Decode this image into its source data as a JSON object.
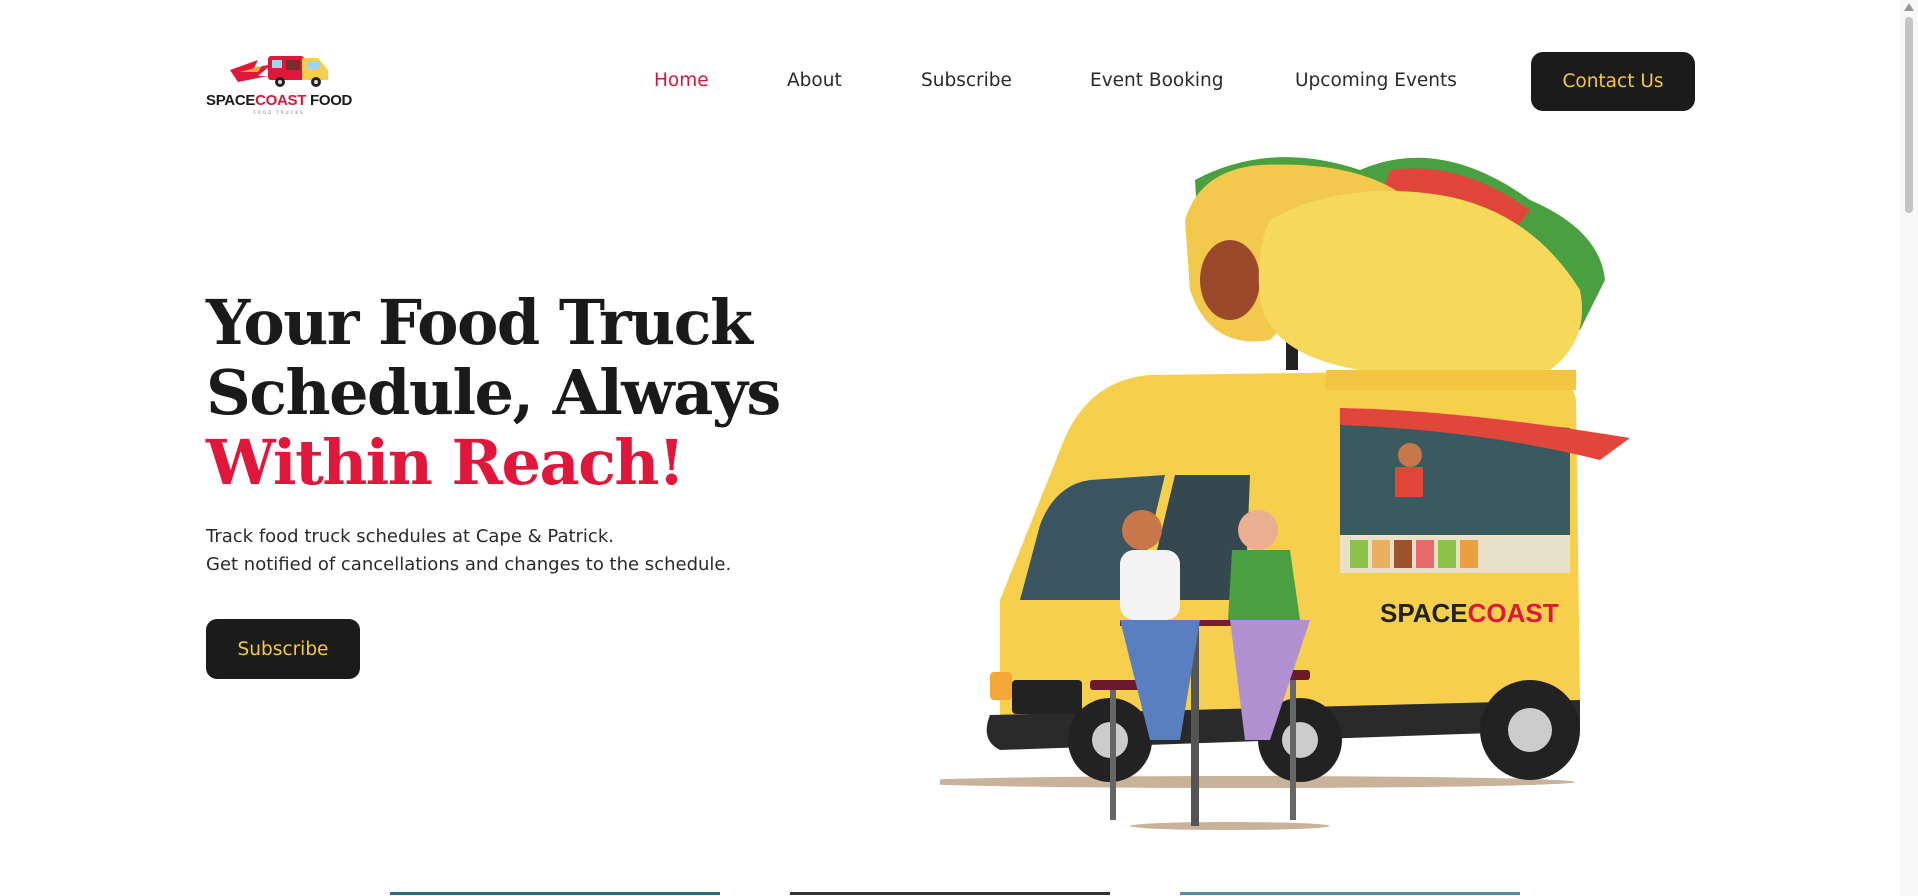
{
  "brand": {
    "name_part1": "SPACE",
    "name_part2": "COAST",
    "name_part3": " FOOD",
    "tagline": "FOOD TRUCKS"
  },
  "nav": {
    "items": [
      {
        "label": "Home",
        "active": true
      },
      {
        "label": "About"
      },
      {
        "label": "Subscribe"
      },
      {
        "label": "Event Booking"
      },
      {
        "label": "Upcoming Events"
      }
    ],
    "contact_label": "Contact Us"
  },
  "hero": {
    "title_line1": "Your Food Truck",
    "title_line2": "Schedule, Always",
    "title_line3": "Within Reach!",
    "desc_line1": "Track food truck schedules at Cape & Patrick.",
    "desc_line2": "Get notified of cancellations and changes to the schedule.",
    "subscribe_label": "Subscribe",
    "truck_brand_part1": "SPACE",
    "truck_brand_part2": "COAST"
  },
  "colors": {
    "accent_red": "#e0163a",
    "dark_button": "#1b1b1b",
    "button_text_yellow": "#f5c93a",
    "truck_yellow": "#f6d04d"
  },
  "icons": [
    "food-truck-logo-icon",
    "scroll-up-arrow-icon"
  ]
}
